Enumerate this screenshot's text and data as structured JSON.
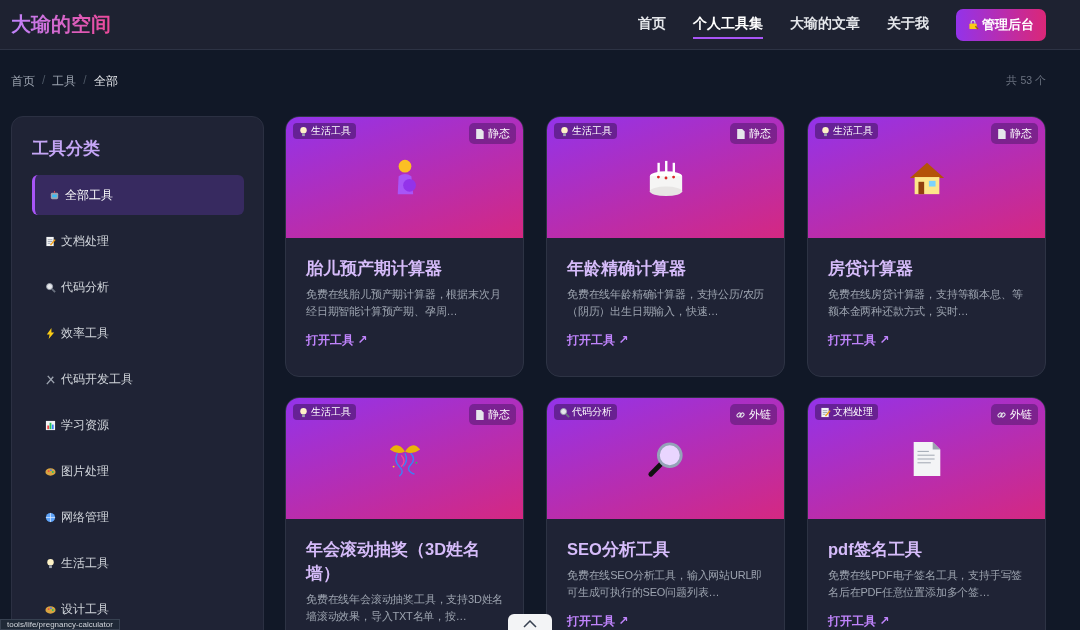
{
  "header": {
    "logo": "大瑜的空间",
    "nav": [
      {
        "label": "首页",
        "selected": false
      },
      {
        "label": "个人工具集",
        "selected": true
      },
      {
        "label": "大瑜的文章",
        "selected": false
      },
      {
        "label": "关于我",
        "selected": false
      }
    ],
    "admin_button": "管理后台"
  },
  "breadcrumb": {
    "separator": "/",
    "items": [
      "首页",
      "工具",
      "全部"
    ]
  },
  "count": "共 53 个",
  "sidebar": {
    "title": "工具分类",
    "items": [
      {
        "label": "全部工具",
        "kind": "robot",
        "selected": true
      },
      {
        "label": "文档处理",
        "kind": "memo",
        "selected": false
      },
      {
        "label": "代码分析",
        "kind": "search",
        "selected": false
      },
      {
        "label": "效率工具",
        "kind": "bolt",
        "selected": false
      },
      {
        "label": "代码开发工具",
        "kind": "tools",
        "selected": false
      },
      {
        "label": "学习资源",
        "kind": "chart",
        "selected": false
      },
      {
        "label": "图片处理",
        "kind": "palette",
        "selected": false
      },
      {
        "label": "网络管理",
        "kind": "globe",
        "selected": false
      },
      {
        "label": "生活工具",
        "kind": "bulb",
        "selected": false
      },
      {
        "label": "设计工具",
        "kind": "palette",
        "selected": false
      }
    ]
  },
  "cards": [
    {
      "category": {
        "label": "生活工具",
        "kind": "bulb"
      },
      "badge": {
        "label": "静态",
        "kind": "static"
      },
      "kind": "pregnant",
      "title": "胎儿预产期计算器",
      "description": "免费在线胎儿预产期计算器，根据末次月经日期智能计算预产期、孕周…",
      "link": "打开工具 ↗"
    },
    {
      "category": {
        "label": "生活工具",
        "kind": "bulb"
      },
      "badge": {
        "label": "静态",
        "kind": "static"
      },
      "kind": "cake",
      "title": "年龄精确计算器",
      "description": "免费在线年龄精确计算器，支持公历/农历（阴历）出生日期输入，快速…",
      "link": "打开工具 ↗"
    },
    {
      "category": {
        "label": "生活工具",
        "kind": "bulb"
      },
      "badge": {
        "label": "静态",
        "kind": "static"
      },
      "kind": "house",
      "title": "房贷计算器",
      "description": "免费在线房贷计算器，支持等额本息、等额本金两种还款方式，实时…",
      "link": "打开工具 ↗"
    },
    {
      "category": {
        "label": "生活工具",
        "kind": "bulb"
      },
      "badge": {
        "label": "静态",
        "kind": "static"
      },
      "kind": "confetti",
      "title": "年会滚动抽奖（3D姓名墙）",
      "description": "免费在线年会滚动抽奖工具，支持3D姓名墙滚动效果，导入TXT名单，按…"
    },
    {
      "category": {
        "label": "代码分析",
        "kind": "search"
      },
      "badge": {
        "label": "外链",
        "kind": "link"
      },
      "kind": "magnifier",
      "title": "SEO分析工具",
      "description": "免费在线SEO分析工具，输入网站URL即可生成可执行的SEO问题列表…",
      "link": "打开工具 ↗"
    },
    {
      "category": {
        "label": "文档处理",
        "kind": "memo"
      },
      "badge": {
        "label": "外链",
        "kind": "link"
      },
      "kind": "document",
      "title": "pdf签名工具",
      "description": "免费在线PDF电子签名工具，支持手写签名后在PDF任意位置添加多个签…",
      "link": "打开工具 ↗"
    }
  ],
  "status_url": "tools/life/pregnancy-calculator"
}
